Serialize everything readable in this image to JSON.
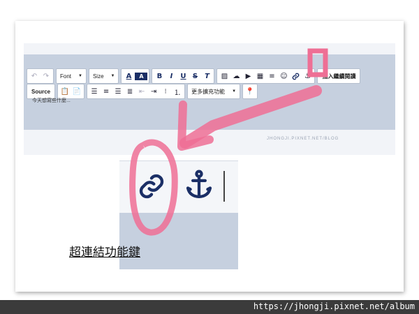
{
  "toolbar": {
    "undo_icon": "undo-icon",
    "redo_icon": "redo-icon",
    "font_label": "Font",
    "size_label": "Size",
    "text_color_glyph": "A",
    "bg_color_glyph": "A",
    "bold_glyph": "B",
    "italic_glyph": "I",
    "underline_glyph": "U",
    "strike_glyph": "S",
    "clear_format_glyph": "T",
    "insert_more_label": "插入繼續閱讀",
    "source_label": "Source",
    "more_features_label": "更多擴充功能"
  },
  "editor": {
    "content_text": "今天想寫些什麼...",
    "watermark": "JHONGJI.PIXNET.NET/BLOG"
  },
  "caption": "超連結功能鍵",
  "footer_url": "https://jhongji.pixnet.net/album",
  "colors": {
    "toolbar_bg": "#c6d0df",
    "highlight_pink": "#ee6f95",
    "icon_navy": "#1b2f66",
    "footer_bg": "#3b3b3b"
  }
}
